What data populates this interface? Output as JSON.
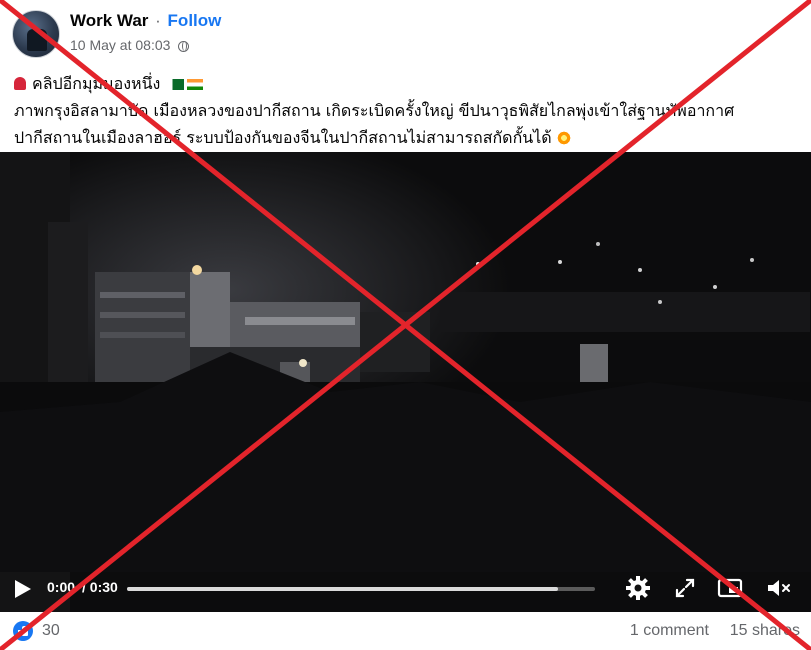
{
  "post": {
    "author": "Work War",
    "separator": "·",
    "follow_label": "Follow",
    "timestamp": "10 May at 08:03",
    "audience_icon": "globe-icon",
    "text_line1": "คลิปอีกมุมมองหนึ่ง",
    "text_line2": "ภาพกรุงอิสลามาบัด เมืองหลวงของปากีสถาน เกิดระเบิดครั้งใหญ่ ขีปนาวุธพิสัยไกลพุ่งเข้าใส่ฐานทัพอากาศ",
    "text_line3": "ปากีสถานในเมืองลาฮอร์ ระบบป้องกันของจีนในปากีสถานไม่สามารถสกัดกั้นได้",
    "emojis": [
      "siren",
      "flag-pakistan",
      "flag-india",
      "collision"
    ]
  },
  "video": {
    "current_time": "0:00",
    "duration": "/ 0:30",
    "progress_buffered": 0.92,
    "controls": [
      "play-icon",
      "settings-icon",
      "fullscreen-icon",
      "picture-in-picture-icon",
      "volume-icon"
    ]
  },
  "footer": {
    "reaction_count": "30",
    "comments": "1 comment",
    "shares": "15 shares"
  },
  "overlay": {
    "cross_color": "#e3242b"
  },
  "colors": {
    "link_blue": "#1877f2",
    "meta_gray": "#65676b"
  }
}
